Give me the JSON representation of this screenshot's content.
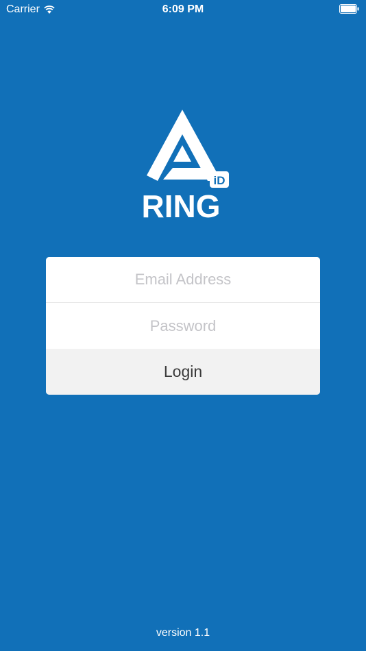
{
  "status_bar": {
    "carrier": "Carrier",
    "time": "6:09 PM",
    "wifi_icon": "wifi-icon",
    "battery_icon": "battery-icon"
  },
  "logo": {
    "wordmark": "RING",
    "badge": "iD",
    "icon": "ring-id-logo"
  },
  "login": {
    "email_placeholder": "Email Address",
    "password_placeholder": "Password",
    "email_value": "",
    "password_value": "",
    "login_label": "Login"
  },
  "footer": {
    "version": "version 1.1"
  },
  "colors": {
    "background": "#1170b8",
    "card": "#ffffff",
    "button": "#f2f2f2",
    "placeholder": "#c4c4c8"
  }
}
